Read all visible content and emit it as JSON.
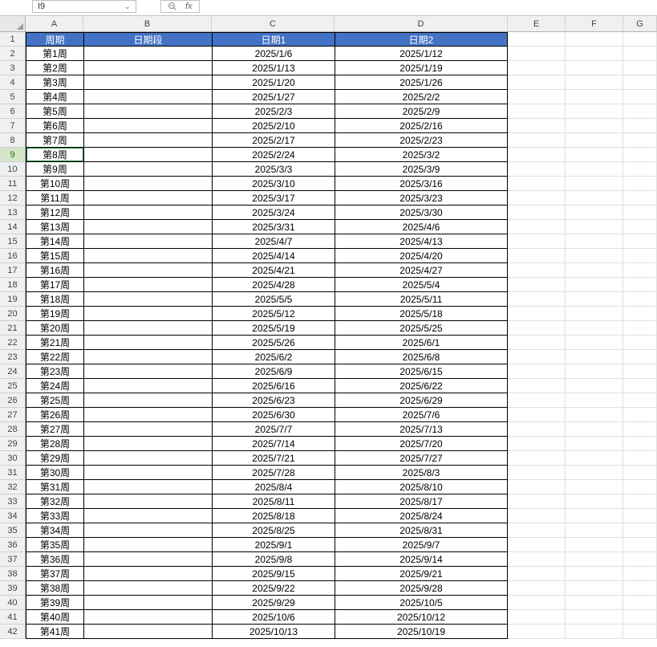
{
  "toolbar": {
    "namebox_value": "I9",
    "fx_label": "fx"
  },
  "columns": [
    {
      "letter": "A",
      "cls": "colA"
    },
    {
      "letter": "B",
      "cls": "colB"
    },
    {
      "letter": "C",
      "cls": "colC"
    },
    {
      "letter": "D",
      "cls": "colD"
    },
    {
      "letter": "E",
      "cls": "colE"
    },
    {
      "letter": "F",
      "cls": "colF"
    },
    {
      "letter": "G",
      "cls": "colG"
    }
  ],
  "headers": {
    "A": "周期",
    "B": "日期段",
    "C": "日期1",
    "D": "日期2"
  },
  "active_row": 9,
  "rows": [
    {
      "n": 1,
      "A": "周期",
      "B": "日期段",
      "C": "日期1",
      "D": "日期2",
      "header": true
    },
    {
      "n": 2,
      "A": "第1周",
      "B": "",
      "C": "2025/1/6",
      "D": "2025/1/12"
    },
    {
      "n": 3,
      "A": "第2周",
      "B": "",
      "C": "2025/1/13",
      "D": "2025/1/19"
    },
    {
      "n": 4,
      "A": "第3周",
      "B": "",
      "C": "2025/1/20",
      "D": "2025/1/26"
    },
    {
      "n": 5,
      "A": "第4周",
      "B": "",
      "C": "2025/1/27",
      "D": "2025/2/2"
    },
    {
      "n": 6,
      "A": "第5周",
      "B": "",
      "C": "2025/2/3",
      "D": "2025/2/9"
    },
    {
      "n": 7,
      "A": "第6周",
      "B": "",
      "C": "2025/2/10",
      "D": "2025/2/16"
    },
    {
      "n": 8,
      "A": "第7周",
      "B": "",
      "C": "2025/2/17",
      "D": "2025/2/23"
    },
    {
      "n": 9,
      "A": "第8周",
      "B": "",
      "C": "2025/2/24",
      "D": "2025/3/2"
    },
    {
      "n": 10,
      "A": "第9周",
      "B": "",
      "C": "2025/3/3",
      "D": "2025/3/9"
    },
    {
      "n": 11,
      "A": "第10周",
      "B": "",
      "C": "2025/3/10",
      "D": "2025/3/16"
    },
    {
      "n": 12,
      "A": "第11周",
      "B": "",
      "C": "2025/3/17",
      "D": "2025/3/23"
    },
    {
      "n": 13,
      "A": "第12周",
      "B": "",
      "C": "2025/3/24",
      "D": "2025/3/30"
    },
    {
      "n": 14,
      "A": "第13周",
      "B": "",
      "C": "2025/3/31",
      "D": "2025/4/6"
    },
    {
      "n": 15,
      "A": "第14周",
      "B": "",
      "C": "2025/4/7",
      "D": "2025/4/13"
    },
    {
      "n": 16,
      "A": "第15周",
      "B": "",
      "C": "2025/4/14",
      "D": "2025/4/20"
    },
    {
      "n": 17,
      "A": "第16周",
      "B": "",
      "C": "2025/4/21",
      "D": "2025/4/27"
    },
    {
      "n": 18,
      "A": "第17周",
      "B": "",
      "C": "2025/4/28",
      "D": "2025/5/4"
    },
    {
      "n": 19,
      "A": "第18周",
      "B": "",
      "C": "2025/5/5",
      "D": "2025/5/11"
    },
    {
      "n": 20,
      "A": "第19周",
      "B": "",
      "C": "2025/5/12",
      "D": "2025/5/18"
    },
    {
      "n": 21,
      "A": "第20周",
      "B": "",
      "C": "2025/5/19",
      "D": "2025/5/25"
    },
    {
      "n": 22,
      "A": "第21周",
      "B": "",
      "C": "2025/5/26",
      "D": "2025/6/1"
    },
    {
      "n": 23,
      "A": "第22周",
      "B": "",
      "C": "2025/6/2",
      "D": "2025/6/8"
    },
    {
      "n": 24,
      "A": "第23周",
      "B": "",
      "C": "2025/6/9",
      "D": "2025/6/15"
    },
    {
      "n": 25,
      "A": "第24周",
      "B": "",
      "C": "2025/6/16",
      "D": "2025/6/22"
    },
    {
      "n": 26,
      "A": "第25周",
      "B": "",
      "C": "2025/6/23",
      "D": "2025/6/29"
    },
    {
      "n": 27,
      "A": "第26周",
      "B": "",
      "C": "2025/6/30",
      "D": "2025/7/6"
    },
    {
      "n": 28,
      "A": "第27周",
      "B": "",
      "C": "2025/7/7",
      "D": "2025/7/13"
    },
    {
      "n": 29,
      "A": "第28周",
      "B": "",
      "C": "2025/7/14",
      "D": "2025/7/20"
    },
    {
      "n": 30,
      "A": "第29周",
      "B": "",
      "C": "2025/7/21",
      "D": "2025/7/27"
    },
    {
      "n": 31,
      "A": "第30周",
      "B": "",
      "C": "2025/7/28",
      "D": "2025/8/3"
    },
    {
      "n": 32,
      "A": "第31周",
      "B": "",
      "C": "2025/8/4",
      "D": "2025/8/10"
    },
    {
      "n": 33,
      "A": "第32周",
      "B": "",
      "C": "2025/8/11",
      "D": "2025/8/17"
    },
    {
      "n": 34,
      "A": "第33周",
      "B": "",
      "C": "2025/8/18",
      "D": "2025/8/24"
    },
    {
      "n": 35,
      "A": "第34周",
      "B": "",
      "C": "2025/8/25",
      "D": "2025/8/31"
    },
    {
      "n": 36,
      "A": "第35周",
      "B": "",
      "C": "2025/9/1",
      "D": "2025/9/7"
    },
    {
      "n": 37,
      "A": "第36周",
      "B": "",
      "C": "2025/9/8",
      "D": "2025/9/14"
    },
    {
      "n": 38,
      "A": "第37周",
      "B": "",
      "C": "2025/9/15",
      "D": "2025/9/21"
    },
    {
      "n": 39,
      "A": "第38周",
      "B": "",
      "C": "2025/9/22",
      "D": "2025/9/28"
    },
    {
      "n": 40,
      "A": "第39周",
      "B": "",
      "C": "2025/9/29",
      "D": "2025/10/5"
    },
    {
      "n": 41,
      "A": "第40周",
      "B": "",
      "C": "2025/10/6",
      "D": "2025/10/12"
    },
    {
      "n": 42,
      "A": "第41周",
      "B": "",
      "C": "2025/10/13",
      "D": "2025/10/19"
    }
  ]
}
